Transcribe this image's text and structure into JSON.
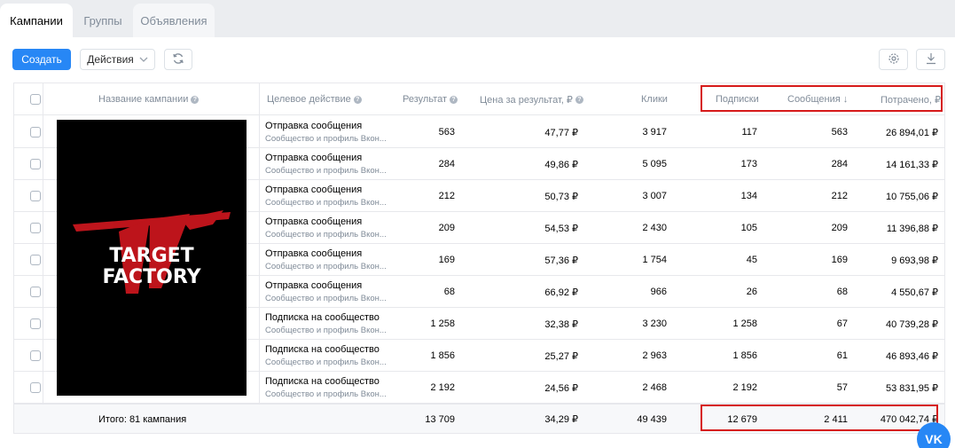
{
  "tabs": [
    {
      "label": "Кампании",
      "active": true
    },
    {
      "label": "Группы",
      "active": false
    },
    {
      "label": "Объявления",
      "active": false
    }
  ],
  "toolbar": {
    "create_label": "Создать",
    "actions_label": "Действия"
  },
  "columns": {
    "name": "Название кампании",
    "goal": "Целевое действие",
    "result": "Результат",
    "cost_per_result": "Цена за результат, ₽",
    "clicks": "Клики",
    "subscriptions": "Подписки",
    "messages": "Сообщения",
    "spent": "Потрачено, ₽"
  },
  "rows": [
    {
      "goal": "Отправка сообщения",
      "goal_sub": "Сообщество и профиль Вкон...",
      "result": "563",
      "cpr": "47,77 ₽",
      "clicks": "3 917",
      "subs": "117",
      "msgs": "563",
      "spent": "26 894,01 ₽"
    },
    {
      "goal": "Отправка сообщения",
      "goal_sub": "Сообщество и профиль Вкон...",
      "result": "284",
      "cpr": "49,86 ₽",
      "clicks": "5 095",
      "subs": "173",
      "msgs": "284",
      "spent": "14 161,33 ₽"
    },
    {
      "goal": "Отправка сообщения",
      "goal_sub": "Сообщество и профиль Вкон...",
      "result": "212",
      "cpr": "50,73 ₽",
      "clicks": "3 007",
      "subs": "134",
      "msgs": "212",
      "spent": "10 755,06 ₽"
    },
    {
      "goal": "Отправка сообщения",
      "goal_sub": "Сообщество и профиль Вкон...",
      "result": "209",
      "cpr": "54,53 ₽",
      "clicks": "2 430",
      "subs": "105",
      "msgs": "209",
      "spent": "11 396,88 ₽"
    },
    {
      "goal": "Отправка сообщения",
      "goal_sub": "Сообщество и профиль Вкон...",
      "result": "169",
      "cpr": "57,36 ₽",
      "clicks": "1 754",
      "subs": "45",
      "msgs": "169",
      "spent": "9 693,98 ₽"
    },
    {
      "goal": "Отправка сообщения",
      "goal_sub": "Сообщество и профиль Вкон...",
      "result": "68",
      "cpr": "66,92 ₽",
      "clicks": "966",
      "subs": "26",
      "msgs": "68",
      "spent": "4 550,67 ₽"
    },
    {
      "goal": "Подписка на сообщество",
      "goal_sub": "Сообщество и профиль Вкон...",
      "result": "1 258",
      "cpr": "32,38 ₽",
      "clicks": "3 230",
      "subs": "1 258",
      "msgs": "67",
      "spent": "40 739,28 ₽"
    },
    {
      "goal": "Подписка на сообщество",
      "goal_sub": "Сообщество и профиль Вкон...",
      "result": "1 856",
      "cpr": "25,27 ₽",
      "clicks": "2 963",
      "subs": "1 856",
      "msgs": "61",
      "spent": "46 893,46 ₽"
    },
    {
      "goal": "Подписка на сообщество",
      "goal_sub": "Сообщество и профиль Вкон...",
      "result": "2 192",
      "cpr": "24,56 ₽",
      "clicks": "2 468",
      "subs": "2 192",
      "msgs": "57",
      "spent": "53 831,95 ₽"
    }
  ],
  "totals": {
    "label": "Итого: 81 кампания",
    "result": "13 709",
    "cpr": "34,29 ₽",
    "clicks": "49 439",
    "subs": "12 679",
    "msgs": "2 411",
    "spent": "470 042,74 ₽"
  },
  "logo": {
    "line1": "TARGET",
    "line2": "FACTORY"
  },
  "vk_badge": "VK",
  "colors": {
    "accent": "#2787f5",
    "highlight": "#d61a1a",
    "logo_red": "#c8161d"
  }
}
